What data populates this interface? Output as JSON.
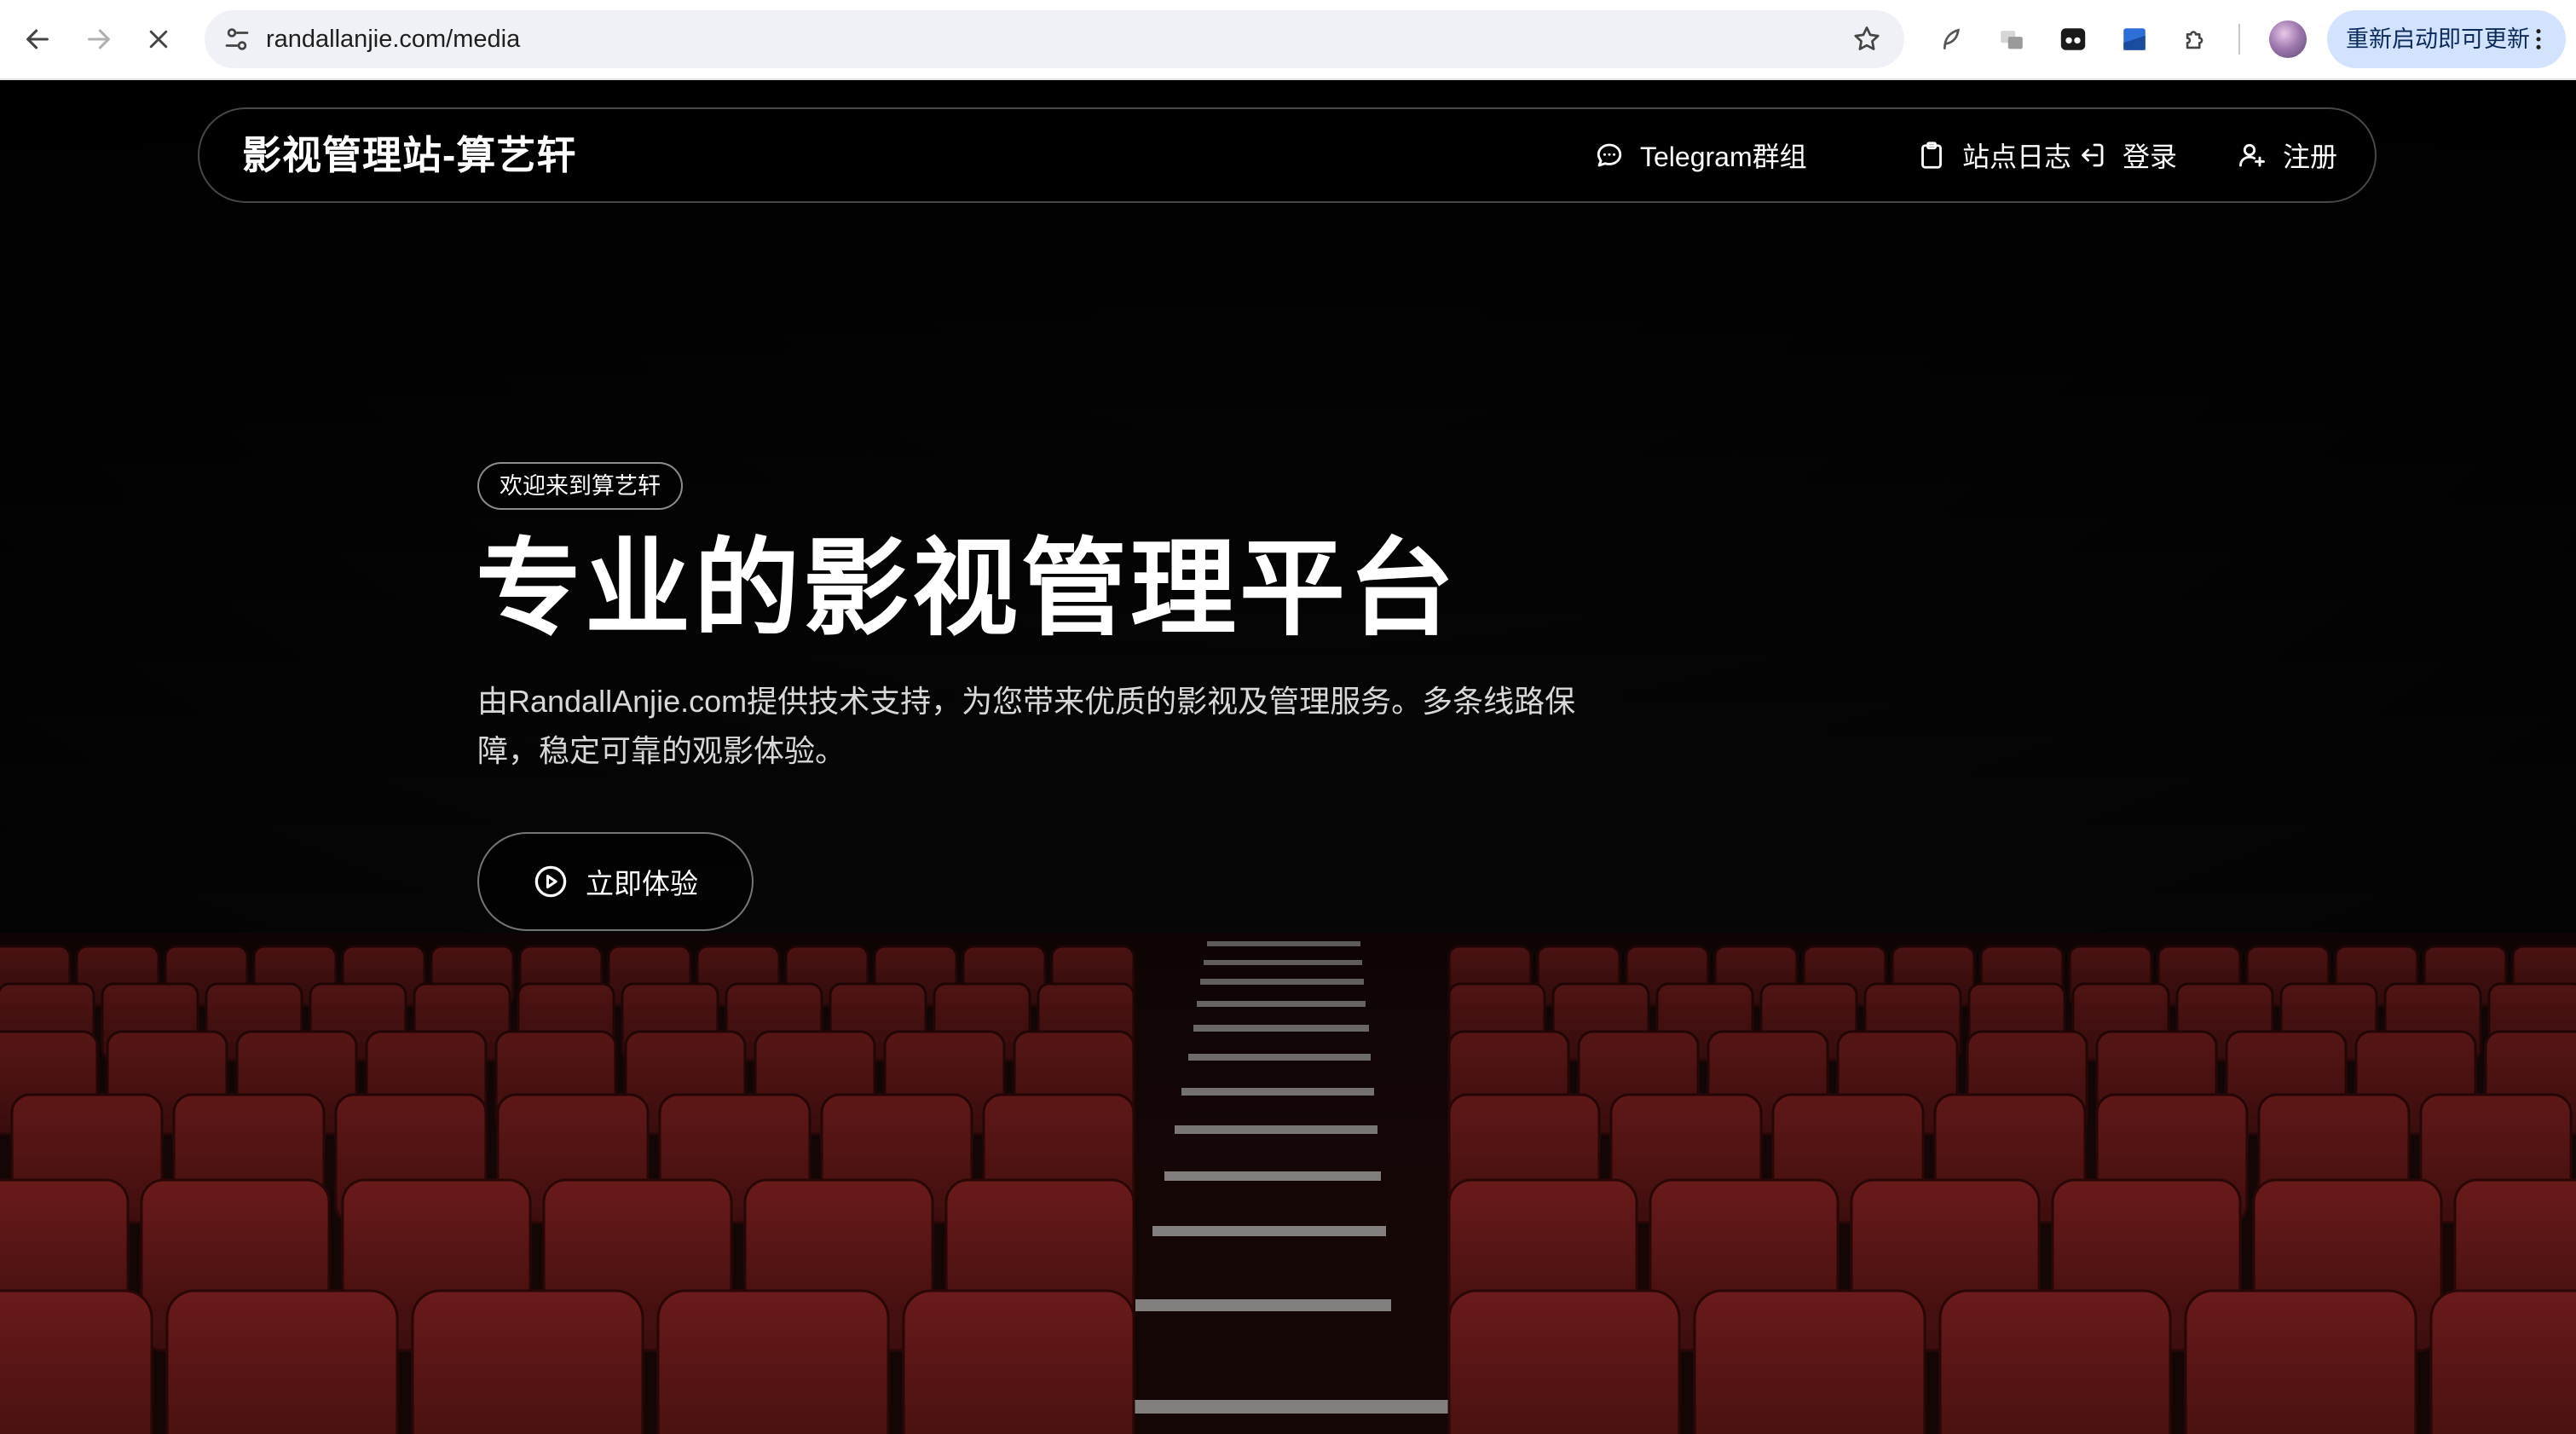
{
  "browser": {
    "url": "randallanjie.com/media",
    "update_label": "重新启动即可更新",
    "back_icon": "arrow-left-icon",
    "forward_icon": "arrow-right-icon",
    "stop_icon": "close-icon"
  },
  "navbar": {
    "title": "影视管理站-算艺轩",
    "items": [
      {
        "label": "Telegram群组",
        "icon": "chat-bubble-icon"
      },
      {
        "label": "站点日志",
        "icon": "clipboard-icon"
      },
      {
        "label": "登录",
        "icon": "login-icon"
      },
      {
        "label": "注册",
        "icon": "user-plus-icon"
      }
    ]
  },
  "hero": {
    "badge": "欢迎来到算艺轩",
    "title": "专业的影视管理平台",
    "description": "由RandallAnjie.com提供技术支持，为您带来优质的影视及管理服务。多条线路保障，稳定可靠的观影体验。",
    "cta_label": "立即体验",
    "cta_icon": "play-circle-icon"
  },
  "colors": {
    "background": "#040404",
    "seat_red": "#5a1414",
    "update_button_bg": "#d3e3fd"
  }
}
